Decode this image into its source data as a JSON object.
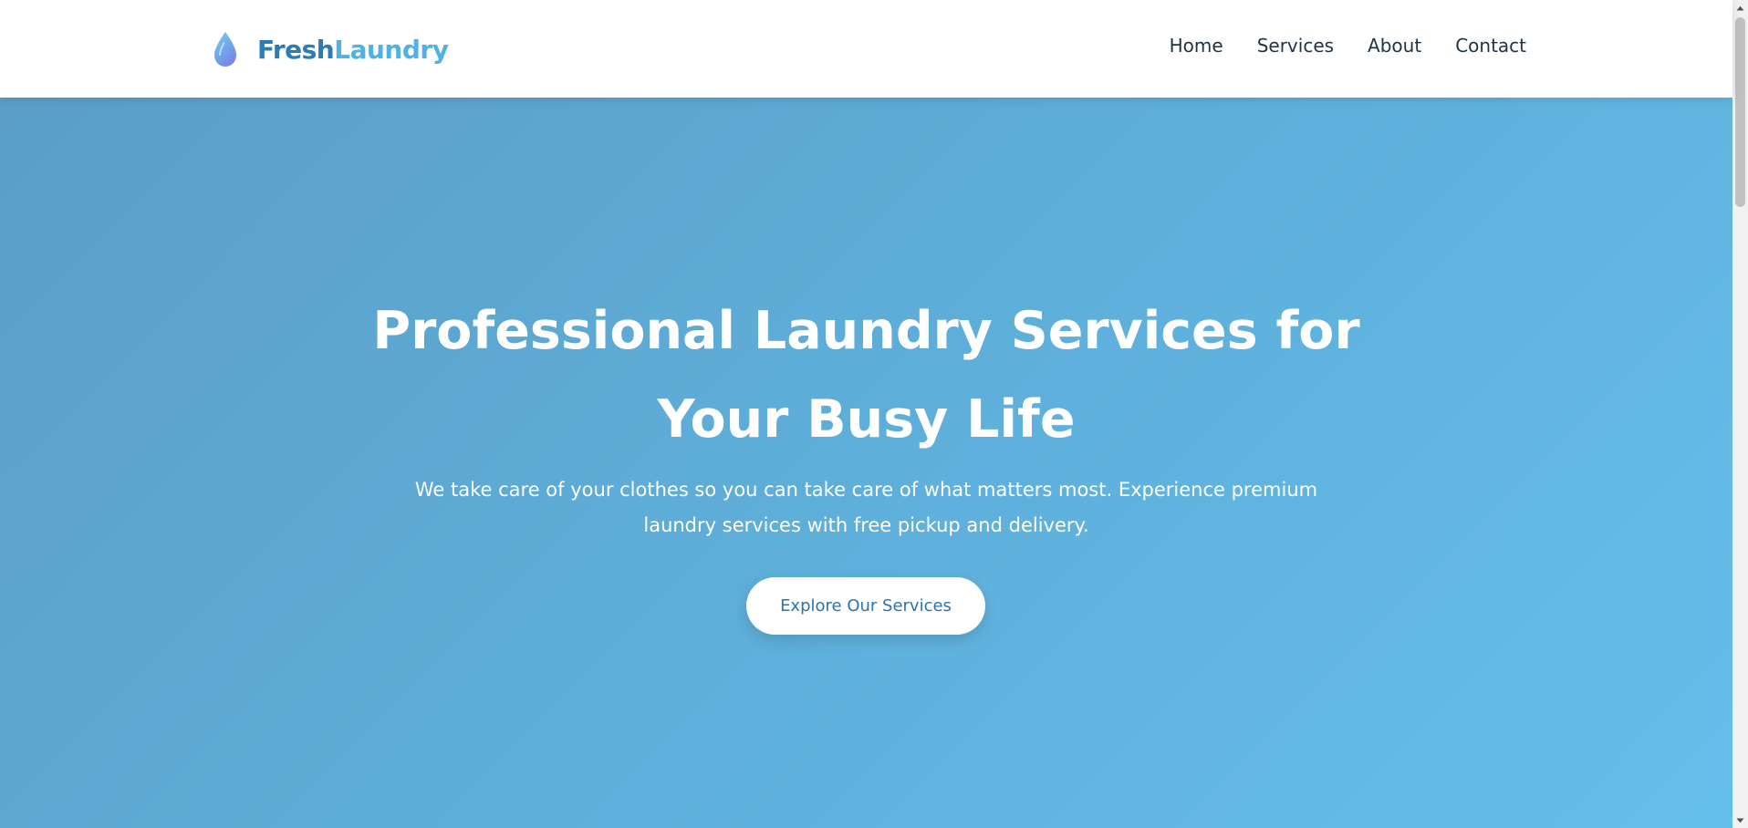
{
  "header": {
    "logo": {
      "icon": "water-drop-icon",
      "brand_part1": "Fresh",
      "brand_part2": "Laundry"
    },
    "nav": [
      {
        "label": "Home"
      },
      {
        "label": "Services"
      },
      {
        "label": "About"
      },
      {
        "label": "Contact"
      }
    ]
  },
  "hero": {
    "title_line1": "Professional Laundry Services for",
    "title_line2": "Your Busy Life",
    "subtitle_line1": "We take care of your clothes so you can take care of what matters most. Experience premium",
    "subtitle_line2": "laundry services with free pickup and delivery.",
    "cta_label": "Explore Our Services"
  },
  "colors": {
    "brand_dark": "#2a7cb8",
    "brand_light": "#4fb2e2",
    "nav_text": "#1f3346",
    "hero_gradient_start": "#5a9ec8",
    "hero_gradient_end": "#64bfea",
    "cta_text": "#2a74ae"
  },
  "scrollbar": {
    "up_icon": "scroll-up-arrow-icon",
    "down_icon": "scroll-down-arrow-icon"
  }
}
